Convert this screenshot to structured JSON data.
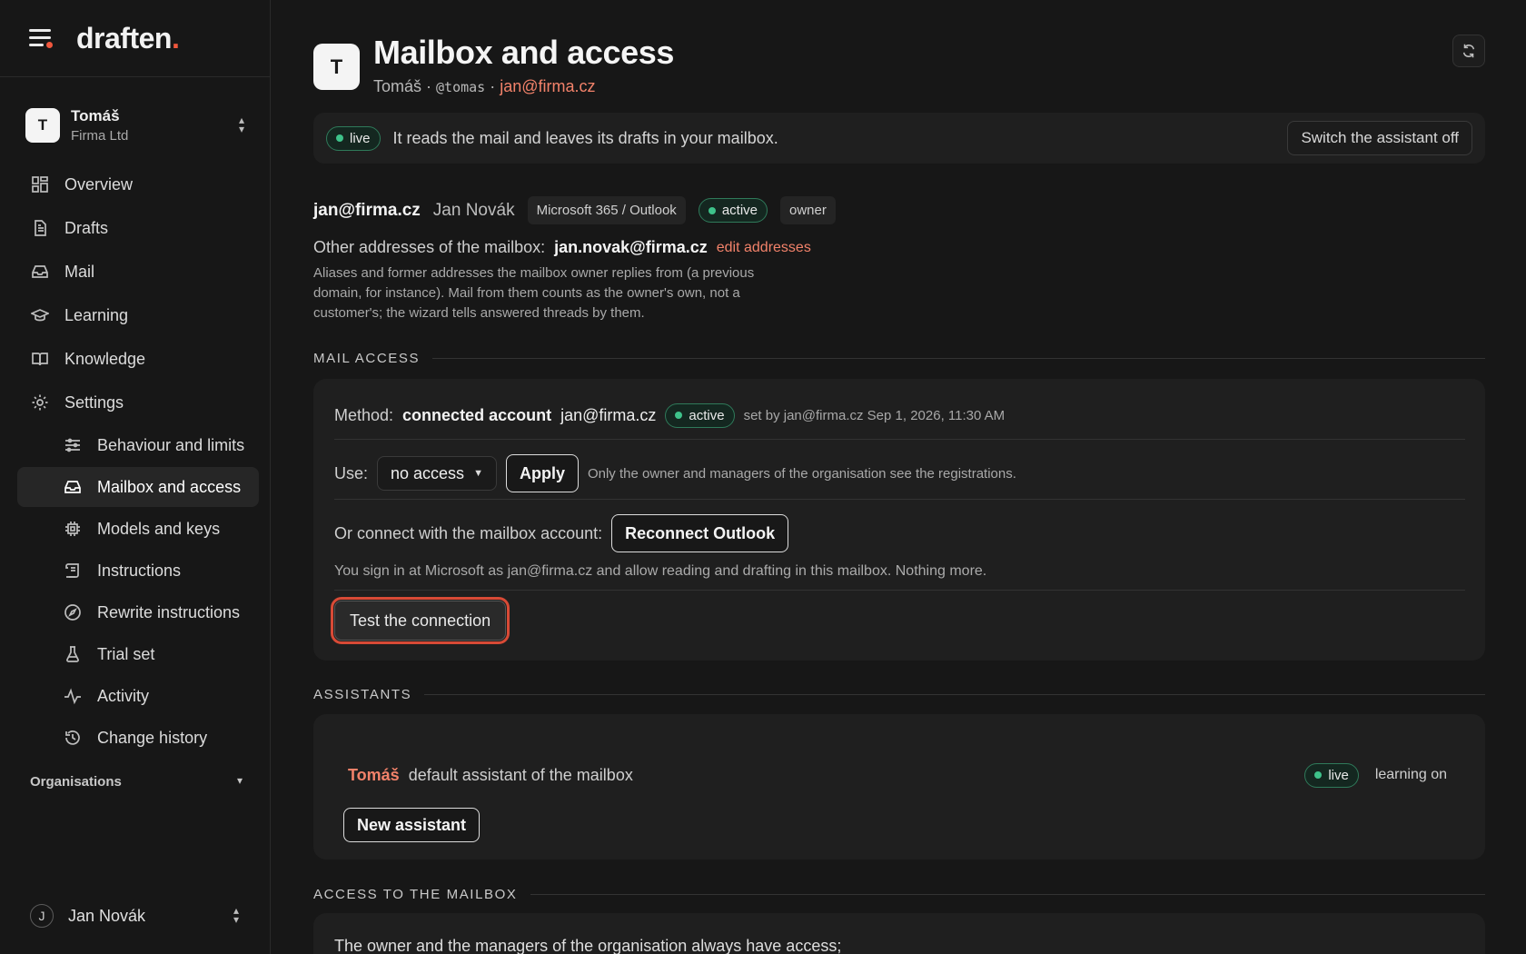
{
  "brand": {
    "name": "draften",
    "dot": "."
  },
  "org_switch": {
    "avatar_letter": "T",
    "name": "Tomáš",
    "sub": "Firma Ltd"
  },
  "nav": {
    "overview": "Overview",
    "drafts": "Drafts",
    "mail": "Mail",
    "learning": "Learning",
    "knowledge": "Knowledge",
    "settings": "Settings",
    "sub": {
      "behaviour": "Behaviour and limits",
      "mailbox": "Mailbox and access",
      "models": "Models and keys",
      "instructions": "Instructions",
      "rewrite": "Rewrite instructions",
      "trial": "Trial set",
      "activity": "Activity",
      "history": "Change history"
    }
  },
  "organisations_label": "Organisations",
  "user": {
    "initial": "J",
    "name": "Jan Novák"
  },
  "header": {
    "avatar_letter": "T",
    "title": "Mailbox and access",
    "sub_name": "Tomáš",
    "sub_sep1": " · ",
    "sub_handle": "@tomas",
    "sub_sep2": " · ",
    "sub_email": "jan@firma.cz"
  },
  "banner": {
    "status": "live",
    "text": "It reads the mail and leaves its drafts in your mailbox.",
    "switch_off_label": "Switch the assistant off"
  },
  "account": {
    "email": "jan@firma.cz",
    "name": "Jan Novák",
    "provider": "Microsoft 365 / Outlook",
    "status": "active",
    "role": "owner"
  },
  "aliases": {
    "label": "Other addresses of the mailbox:",
    "value": "jan.novak@firma.cz",
    "edit": "edit addresses",
    "help": "Aliases and former addresses the mailbox owner replies from (a previous domain, for instance). Mail from them counts as the owner's own, not a customer's; the wizard tells answered threads by them."
  },
  "mail_access": {
    "section": "MAIL ACCESS",
    "method_label": "Method:",
    "method_value": "connected account",
    "method_email": "jan@firma.cz",
    "method_status": "active",
    "set_by": "set by jan@firma.cz Sep 1, 2026, 11:30 AM",
    "use_label": "Use:",
    "use_selected": "no access",
    "apply": "Apply",
    "use_hint": "Only the owner and managers of the organisation see the registrations.",
    "connect_label": "Or connect with the mailbox account:",
    "reconnect": "Reconnect Outlook",
    "connect_hint": "You sign in at Microsoft as jan@firma.cz and allow reading and drafting in this mailbox. Nothing more.",
    "test": "Test the connection"
  },
  "assistants": {
    "section": "ASSISTANTS",
    "name": "Tomáš",
    "desc": "default assistant of the mailbox",
    "status": "live",
    "learning": "learning on",
    "new": "New assistant"
  },
  "access": {
    "section": "ACCESS TO THE MAILBOX",
    "text": "The owner and the managers of the organisation always have access;"
  },
  "colors": {
    "accent": "#f0573d",
    "link": "#f2826a",
    "live_green": "#3ec28a",
    "bg": "#171717",
    "card": "#1f1f1f"
  }
}
